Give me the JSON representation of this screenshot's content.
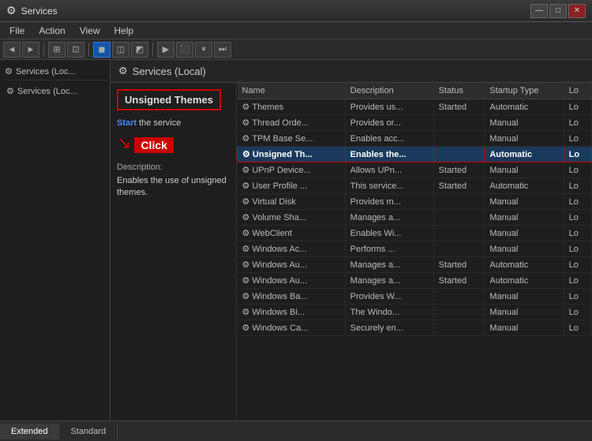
{
  "titlebar": {
    "icon": "⚙",
    "title": "Services",
    "controls": {
      "minimize": "—",
      "maximize": "□",
      "close": "✕"
    }
  },
  "menubar": {
    "items": [
      "File",
      "Action",
      "View",
      "Help"
    ]
  },
  "toolbar": {
    "buttons": [
      "◄",
      "►",
      "⬛",
      "⏸",
      "⏭"
    ]
  },
  "leftpanel": {
    "header": "Services (Local)",
    "icon": "⚙"
  },
  "rightpanel": {
    "header": "Services (Local)",
    "icon": "⚙"
  },
  "infopanel": {
    "selected_label": "Unsigned Themes",
    "start_text": "Start",
    "the_service_text": " the service",
    "click_label": "Click",
    "description_title": "Description:",
    "description_text": "Enables the use of unsigned themes."
  },
  "table": {
    "columns": [
      "Name",
      "Description",
      "Status",
      "Startup Type",
      "Lo"
    ],
    "rows": [
      {
        "name": "Themes",
        "desc": "Provides us...",
        "status": "Started",
        "startup": "Automatic",
        "lo": "Lo",
        "selected": false
      },
      {
        "name": "Thread Orde...",
        "desc": "Provides or...",
        "status": "",
        "startup": "Manual",
        "lo": "Lo",
        "selected": false
      },
      {
        "name": "TPM Base Se...",
        "desc": "Enables acc...",
        "status": "",
        "startup": "Manual",
        "lo": "Lo",
        "selected": false
      },
      {
        "name": "Unsigned Th...",
        "desc": "Enables the...",
        "status": "",
        "startup": "Automatic",
        "lo": "Lo",
        "selected": true
      },
      {
        "name": "UPnP Device...",
        "desc": "Allows UPn...",
        "status": "Started",
        "startup": "Manual",
        "lo": "Lo",
        "selected": false
      },
      {
        "name": "User Profile ...",
        "desc": "This service...",
        "status": "Started",
        "startup": "Automatic",
        "lo": "Lo",
        "selected": false
      },
      {
        "name": "Virtual Disk",
        "desc": "Provides m...",
        "status": "",
        "startup": "Manual",
        "lo": "Lo",
        "selected": false
      },
      {
        "name": "Volume Sha...",
        "desc": "Manages a...",
        "status": "",
        "startup": "Manual",
        "lo": "Lo",
        "selected": false
      },
      {
        "name": "WebClient",
        "desc": "Enables Wi...",
        "status": "",
        "startup": "Manual",
        "lo": "Lo",
        "selected": false
      },
      {
        "name": "Windows Ac...",
        "desc": "Performs ...",
        "status": "",
        "startup": "Manual",
        "lo": "Lo",
        "selected": false
      },
      {
        "name": "Windows Au...",
        "desc": "Manages a...",
        "status": "Started",
        "startup": "Automatic",
        "lo": "Lo",
        "selected": false
      },
      {
        "name": "Windows Au...",
        "desc": "Manages a...",
        "status": "Started",
        "startup": "Automatic",
        "lo": "Lo",
        "selected": false
      },
      {
        "name": "Windows Ba...",
        "desc": "Provides W...",
        "status": "",
        "startup": "Manual",
        "lo": "Lo",
        "selected": false
      },
      {
        "name": "Windows Bi...",
        "desc": "The Windo...",
        "status": "",
        "startup": "Manual",
        "lo": "Lo",
        "selected": false
      },
      {
        "name": "Windows Ca...",
        "desc": "Securely en...",
        "status": "",
        "startup": "Manual",
        "lo": "Lo",
        "selected": false
      }
    ]
  },
  "statusbar": {
    "tabs": [
      "Extended",
      "Standard"
    ]
  }
}
